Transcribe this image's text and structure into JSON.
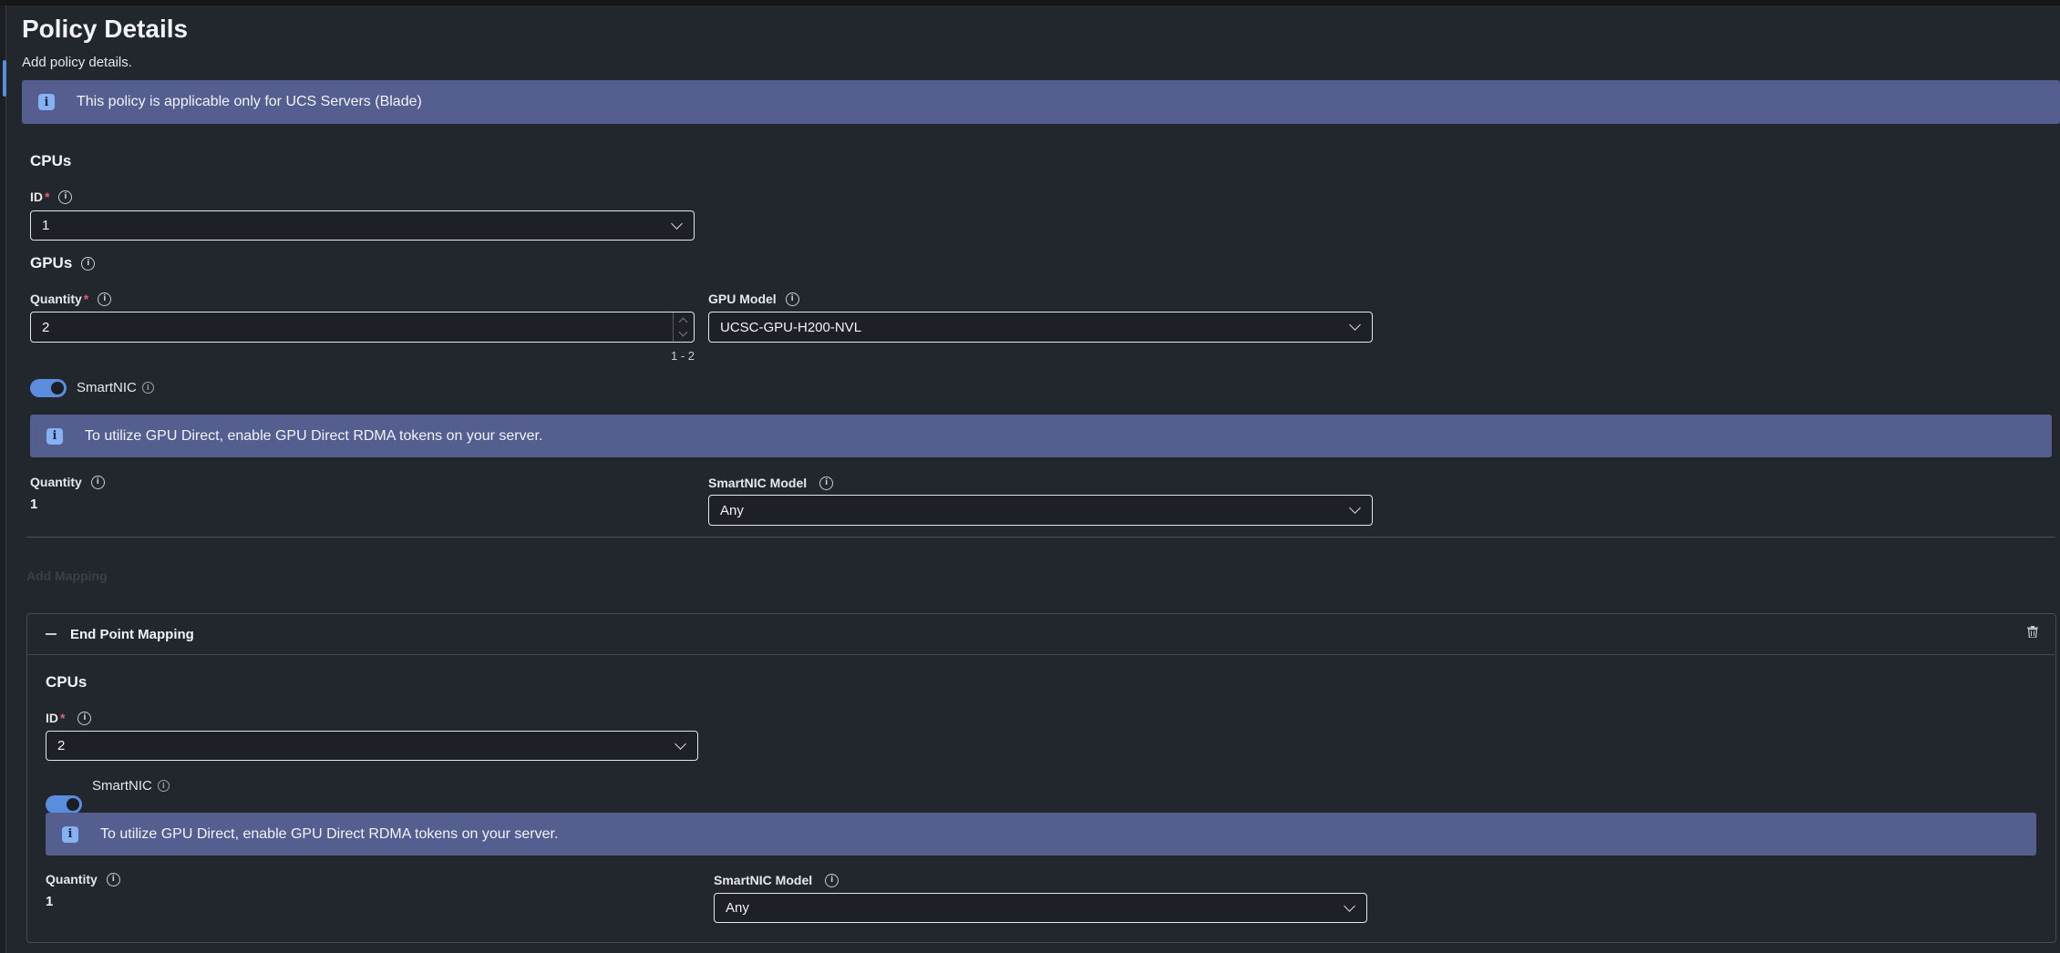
{
  "page": {
    "title": "Policy Details",
    "subtitle": "Add policy details."
  },
  "banner_main": {
    "text": "This policy is applicable only for UCS Servers (Blade)"
  },
  "cpus": {
    "heading": "CPUs",
    "id_label": "ID",
    "id_value": "1"
  },
  "gpus": {
    "heading": "GPUs",
    "quantity_label": "Quantity",
    "quantity_value": "2",
    "quantity_range": "1 - 2",
    "model_label": "GPU Model",
    "model_value": "UCSC-GPU-H200-NVL"
  },
  "smartnic": {
    "toggle_label": "SmartNIC",
    "banner_text": "To utilize GPU Direct, enable GPU Direct RDMA tokens on your server.",
    "quantity_label": "Quantity",
    "quantity_value": "1",
    "model_label": "SmartNIC Model",
    "model_value": "Any"
  },
  "add_mapping": {
    "label": "Add Mapping"
  },
  "endpoint_mapping": {
    "title": "End Point Mapping",
    "cpus_heading": "CPUs",
    "id_label": "ID",
    "id_value": "2",
    "smartnic_label": "SmartNIC",
    "banner_text": "To utilize GPU Direct, enable GPU Direct RDMA tokens on your server.",
    "quantity_label": "Quantity",
    "quantity_value": "1",
    "model_label": "SmartNIC Model",
    "model_value": "Any"
  },
  "icons": [
    "info-icon",
    "info-circle-icon",
    "chevron-down-icon",
    "collapse-minus-icon",
    "trash-icon"
  ],
  "colors": {
    "background": "#22262d",
    "banner": "#545e8f",
    "accent": "#5b8dde",
    "required": "#e25d73"
  }
}
